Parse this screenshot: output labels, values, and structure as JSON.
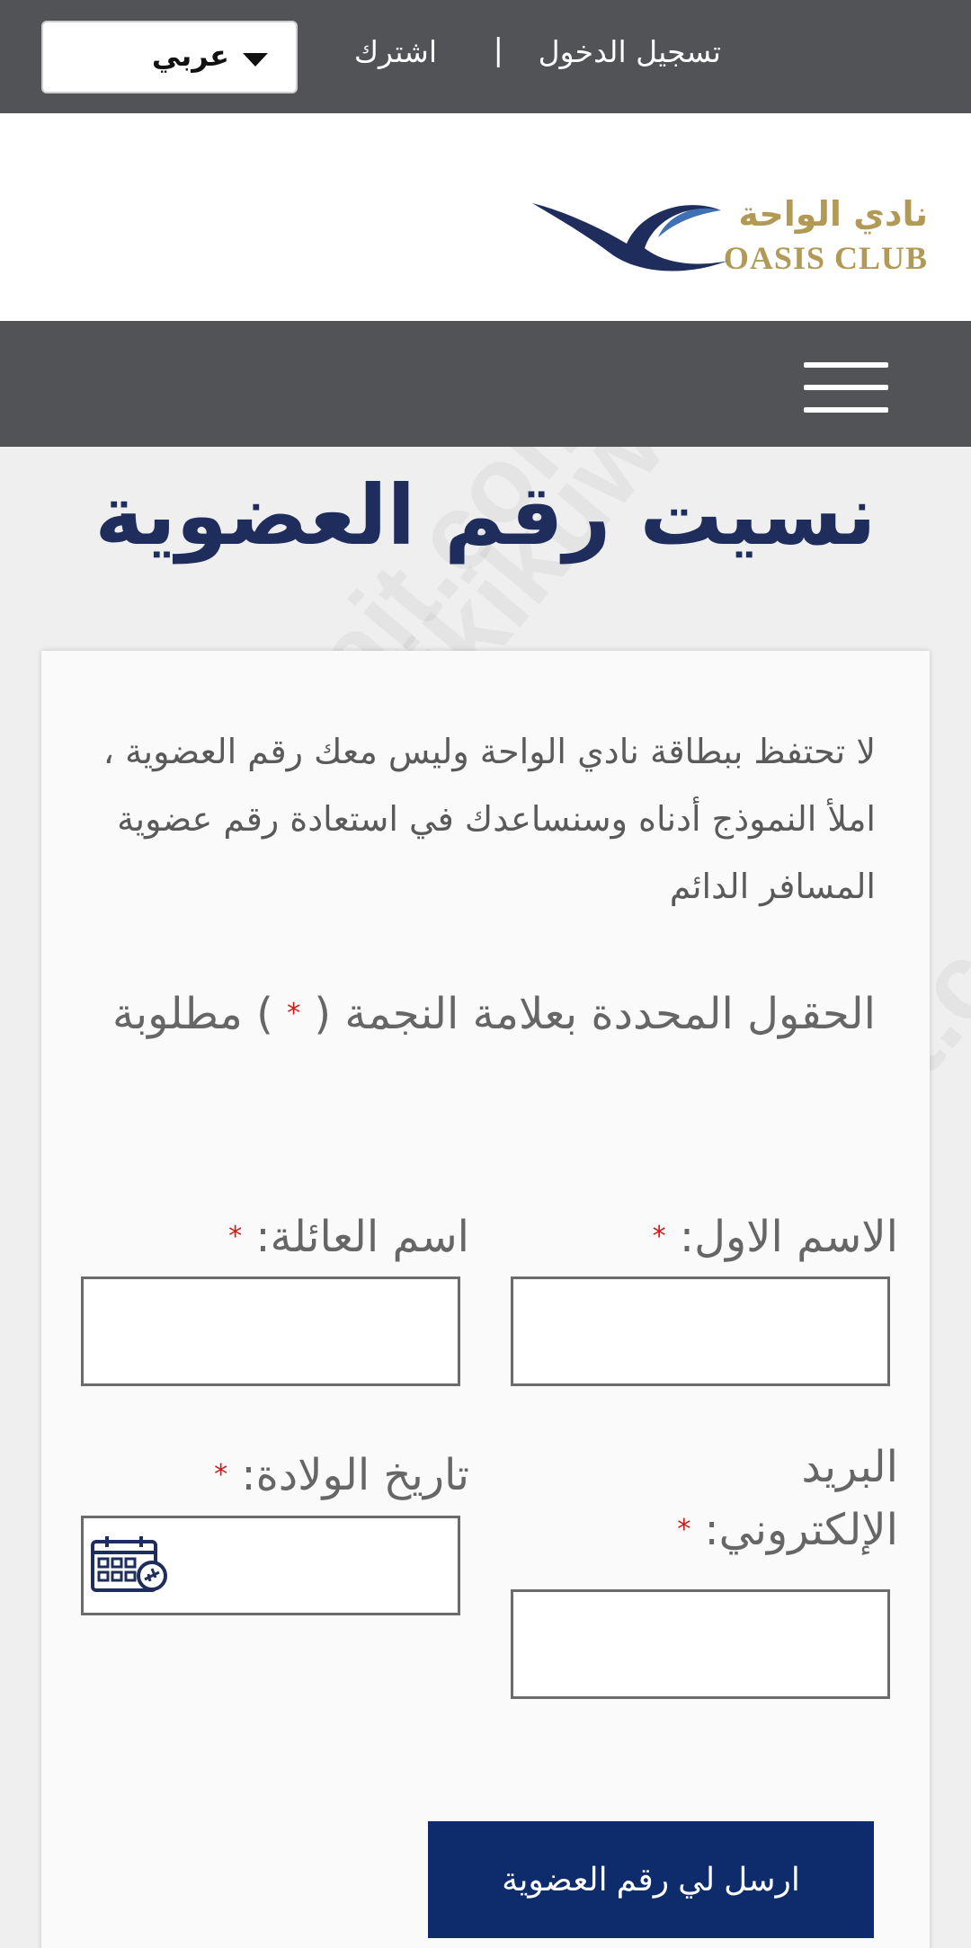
{
  "top_bar": {
    "language_selected": "عربي",
    "login_label": "تسجيل الدخول",
    "separator": "|",
    "signup_label": "اشترك"
  },
  "logo": {
    "arabic_name": "نادي الواحة",
    "english_name": "OASIS CLUB",
    "colors": {
      "gold": "#b29a56",
      "navy": "#1f2d5c",
      "blue": "#3f6fb5"
    }
  },
  "page": {
    "title": "نسيت رقم العضوية",
    "intro": "لا تحتفظ ببطاقة نادي الواحة وليس معك رقم العضوية ، املأ النموذج أدناه وسنساعدك في استعادة رقم عضوية المسافر الدائم",
    "required_note_before": "الحقول المحددة بعلامة النجمة (",
    "required_note_after": ") مطلوبة",
    "required_marker": "*"
  },
  "form": {
    "first_name_label": "الاسم الاول:",
    "last_name_label": "اسم العائلة:",
    "email_label_line1": "البريد",
    "email_label_line2": "الإلكتروني:",
    "dob_label": "تاريخ الولادة:",
    "first_name_value": "",
    "last_name_value": "",
    "email_value": "",
    "dob_value": "",
    "submit_label": "ارسل لي رقم العضوية"
  },
  "watermark_text": "wikikuwait.com",
  "colors": {
    "bar": "#525357",
    "button": "#0e2b6b",
    "required": "#d01a1a"
  }
}
